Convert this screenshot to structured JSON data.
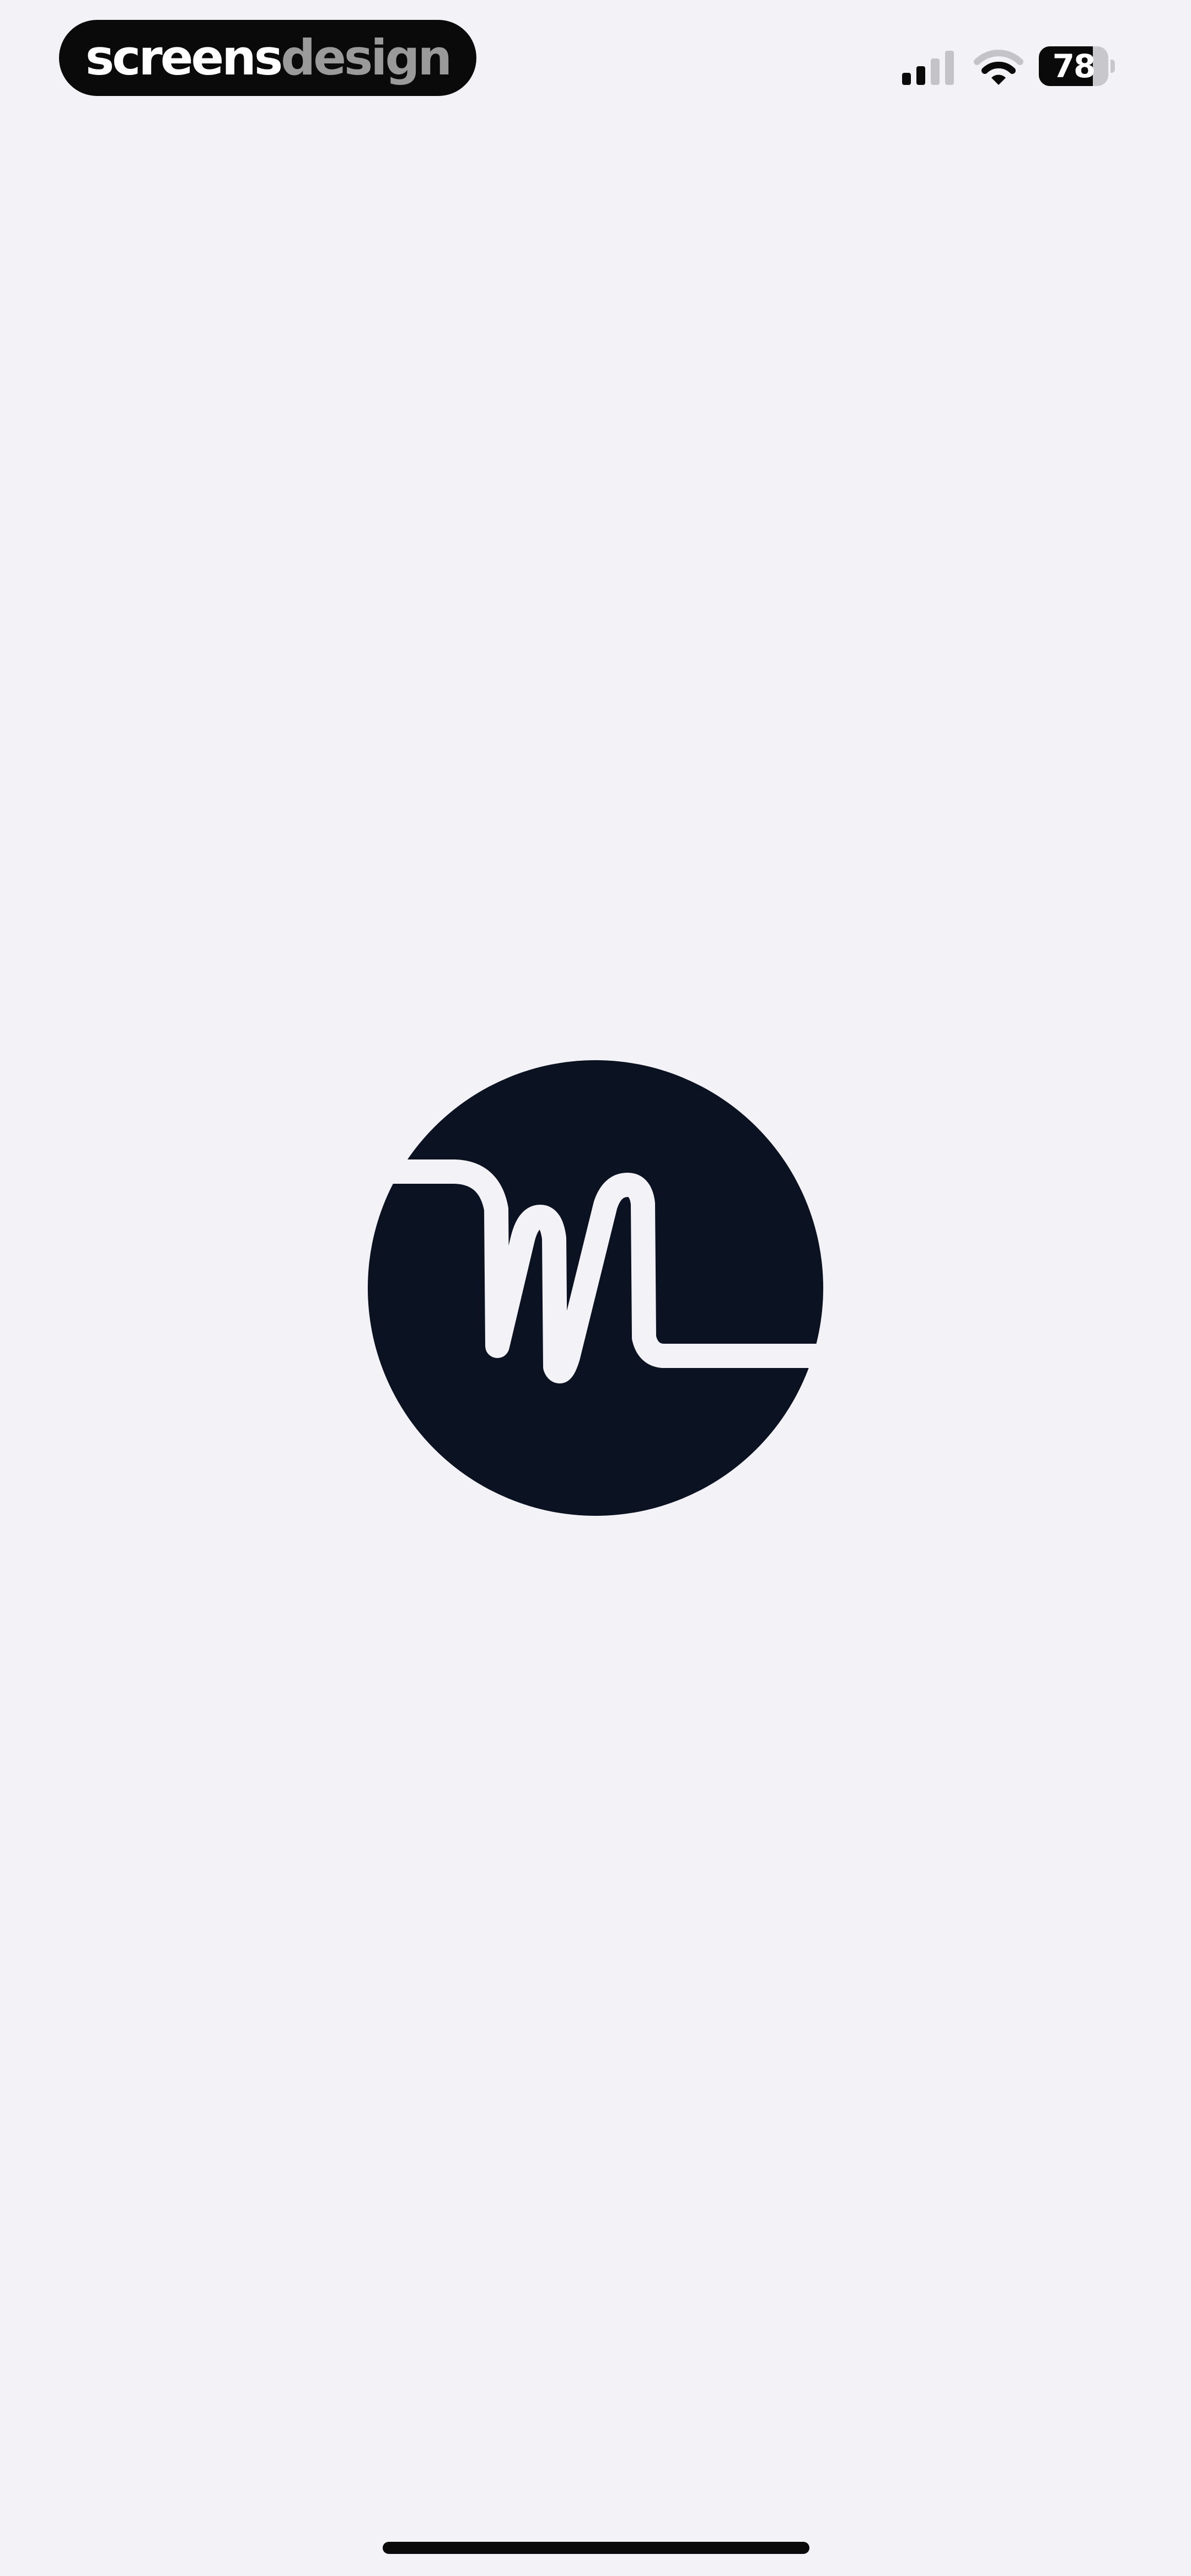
{
  "status_bar": {
    "brand_text_primary": "screens",
    "brand_text_secondary": "design",
    "battery_level": "78",
    "battery_fraction": 0.78,
    "signal_bars_active": 2,
    "signal_bars_total": 4,
    "icons": [
      "cellular-signal-icon",
      "wifi-icon",
      "battery-icon"
    ]
  },
  "splash": {
    "logo_icon": "app-logo-icon",
    "logo_color": "#0b1222",
    "background_color": "#f3f2f6"
  }
}
